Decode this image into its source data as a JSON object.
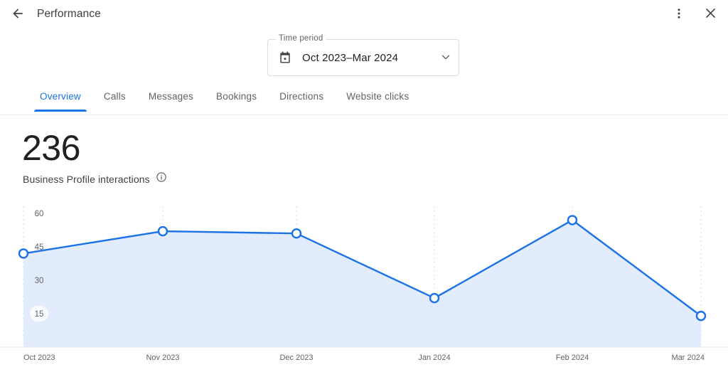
{
  "appbar": {
    "title": "Performance",
    "back_icon": "arrow-back-icon",
    "more_icon": "more-vert-icon",
    "close_icon": "close-icon"
  },
  "time_period": {
    "legend": "Time period",
    "value": "Oct 2023–Mar 2024",
    "calendar_icon": "calendar-icon",
    "dropdown_icon": "chevron-down-icon"
  },
  "tabs": [
    {
      "label": "Overview",
      "active": true
    },
    {
      "label": "Calls",
      "active": false
    },
    {
      "label": "Messages",
      "active": false
    },
    {
      "label": "Bookings",
      "active": false
    },
    {
      "label": "Directions",
      "active": false
    },
    {
      "label": "Website clicks",
      "active": false
    }
  ],
  "metric": {
    "value": "236",
    "label": "Business Profile interactions",
    "info_icon": "info-icon"
  },
  "colors": {
    "accent": "#1a73e8",
    "line": "#1b72e8",
    "area_fill": "#e3ecfd",
    "grid": "#dadce0",
    "text_primary": "#202124",
    "text_secondary": "#5f6368"
  },
  "chart_data": {
    "type": "area",
    "title": "Business Profile interactions",
    "xlabel": "",
    "ylabel": "",
    "categories": [
      "Oct 2023",
      "Nov 2023",
      "Dec 2023",
      "Jan 2024",
      "Feb 2024",
      "Mar 2024"
    ],
    "values": [
      42,
      52,
      51,
      22,
      57,
      14
    ],
    "yticks": [
      15,
      30,
      45,
      60
    ],
    "ylim": [
      0,
      66
    ],
    "grid": "vertical-dashed",
    "legend": "none",
    "markers": "open-circle",
    "total": 236
  }
}
